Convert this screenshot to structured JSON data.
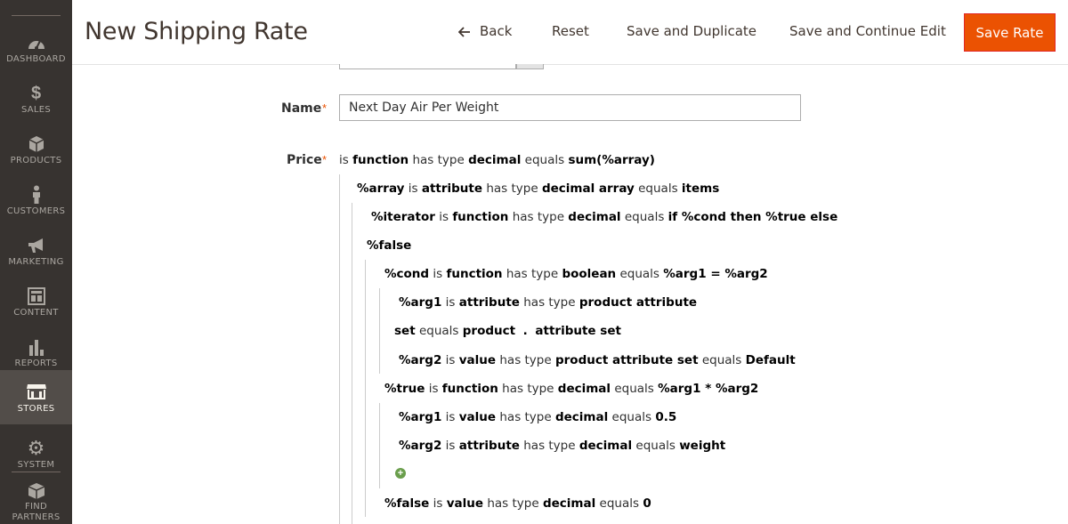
{
  "sidebar": {
    "items": [
      {
        "label": "DASHBOARD",
        "icon": "dashboard-icon"
      },
      {
        "label": "SALES",
        "icon": "dollar-icon"
      },
      {
        "label": "PRODUCTS",
        "icon": "box-icon"
      },
      {
        "label": "CUSTOMERS",
        "icon": "person-icon"
      },
      {
        "label": "MARKETING",
        "icon": "megaphone-icon"
      },
      {
        "label": "CONTENT",
        "icon": "layout-icon"
      },
      {
        "label": "REPORTS",
        "icon": "bar-chart-icon"
      },
      {
        "label": "STORES",
        "icon": "store-icon",
        "active": true
      },
      {
        "label": "SYSTEM",
        "icon": "gear-icon"
      },
      {
        "label": "FIND PARTNERS &",
        "icon": "partners-icon"
      }
    ]
  },
  "header": {
    "title": "New Shipping Rate",
    "back_label": "Back",
    "reset_label": "Reset",
    "save_duplicate_label": "Save and Duplicate",
    "save_continue_label": "Save and Continue Edit",
    "save_label": "Save Rate",
    "accent_color": "#eb5202"
  },
  "form": {
    "name_label": "Name",
    "name_value": "Next Day Air Per Weight",
    "price_label": "Price",
    "required_mark": "*",
    "add_condition_icon": "plus-circle-icon"
  },
  "rules": {
    "r1": {
      "w0": "is",
      "w1": "function",
      "w2": "has type",
      "w3": "decimal",
      "w4": "equals",
      "w5": "sum(%array)"
    },
    "r2": {
      "w0": "%array",
      "w1": "is",
      "w2": "attribute",
      "w3": "has type",
      "w4": "decimal array",
      "w5": "equals",
      "w6": "items"
    },
    "r3": {
      "w0": "%iterator",
      "w1": "is",
      "w2": "function",
      "w3": "has type",
      "w4": "decimal",
      "w5": "equals",
      "w6": "if %cond then %true else"
    },
    "r4": {
      "w0": "%false"
    },
    "r5": {
      "w0": "%cond",
      "w1": "is",
      "w2": "function",
      "w3": "has type",
      "w4": "boolean",
      "w5": "equals",
      "w6": "%arg1 = %arg2"
    },
    "r6": {
      "w0": "%arg1",
      "w1": "is",
      "w2": "attribute",
      "w3": "has type",
      "w4": "product attribute"
    },
    "r7": {
      "w0": "set",
      "w1": "equals",
      "w2": "product",
      "w3": ".",
      "w4": "attribute set"
    },
    "r8": {
      "w0": "%arg2",
      "w1": "is",
      "w2": "value",
      "w3": "has type",
      "w4": "product attribute set",
      "w5": "equals",
      "w6": "Default"
    },
    "r9": {
      "w0": "%true",
      "w1": "is",
      "w2": "function",
      "w3": "has type",
      "w4": "decimal",
      "w5": "equals",
      "w6": "%arg1 * %arg2"
    },
    "r10": {
      "w0": "%arg1",
      "w1": "is",
      "w2": "value",
      "w3": "has type",
      "w4": "decimal",
      "w5": "equals",
      "w6": "0.5"
    },
    "r11": {
      "w0": "%arg2",
      "w1": "is",
      "w2": "attribute",
      "w3": "has type",
      "w4": "decimal",
      "w5": "equals",
      "w6": "weight"
    },
    "r12": {
      "w0": "%false",
      "w1": "is",
      "w2": "value",
      "w3": "has type",
      "w4": "decimal",
      "w5": "equals",
      "w6": "0"
    }
  }
}
